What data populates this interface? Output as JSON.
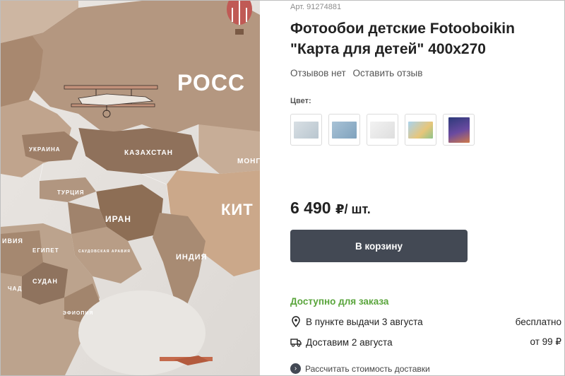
{
  "product": {
    "sku": "Арт. 91274881",
    "title": "Фотообои детские Fotooboikin \"Карта для детей\" 400x270",
    "reviews_count_label": "Отзывов нет",
    "leave_review_label": "Оставить отзыв",
    "color_label": "Цвет:",
    "swatches": [
      {
        "name": "light-gray-map",
        "color": "#c9d4dc"
      },
      {
        "name": "blue-map",
        "color": "#8fb3cc"
      },
      {
        "name": "white-map",
        "color": "#ececec"
      },
      {
        "name": "colorful-map",
        "color": "#9cc8e6"
      },
      {
        "name": "space-image",
        "color": "#4a3c7a"
      }
    ],
    "price": "6 490",
    "currency": "₽",
    "price_unit": "/ шт.",
    "add_to_cart_label": "В корзину",
    "availability": "Доступно для заказа",
    "pickup_label": "В пункте выдачи 3 августа",
    "pickup_value": "бесплатно",
    "delivery_label": "Доставим 2 августа",
    "delivery_value": "от 99 ₽",
    "calc_delivery_label": "Рассчитать стоимость доставки"
  },
  "map_labels": {
    "russia": "РОСС",
    "kazakhstan": "КАЗАХСТАН",
    "ukraina": "УКРАИНА",
    "turkey": "ТУРЦИЯ",
    "iran": "ИРАН",
    "china": "КИТ",
    "india": "ИНДИЯ",
    "mongolia": "МОНГ",
    "egypt": "ЕГИПЕТ",
    "sudan": "СУДАН",
    "saudi": "САУДОВСКАЯ АРАВИЯ",
    "libya": "ИВИЯ",
    "chad": "ЧАД",
    "ethiopia": "ЭФИОПИЯ"
  },
  "colors": {
    "accent_green": "#5aa53c",
    "button_dark": "#434954",
    "map_land": "#b89a82",
    "map_sea": "#e6e2de"
  }
}
